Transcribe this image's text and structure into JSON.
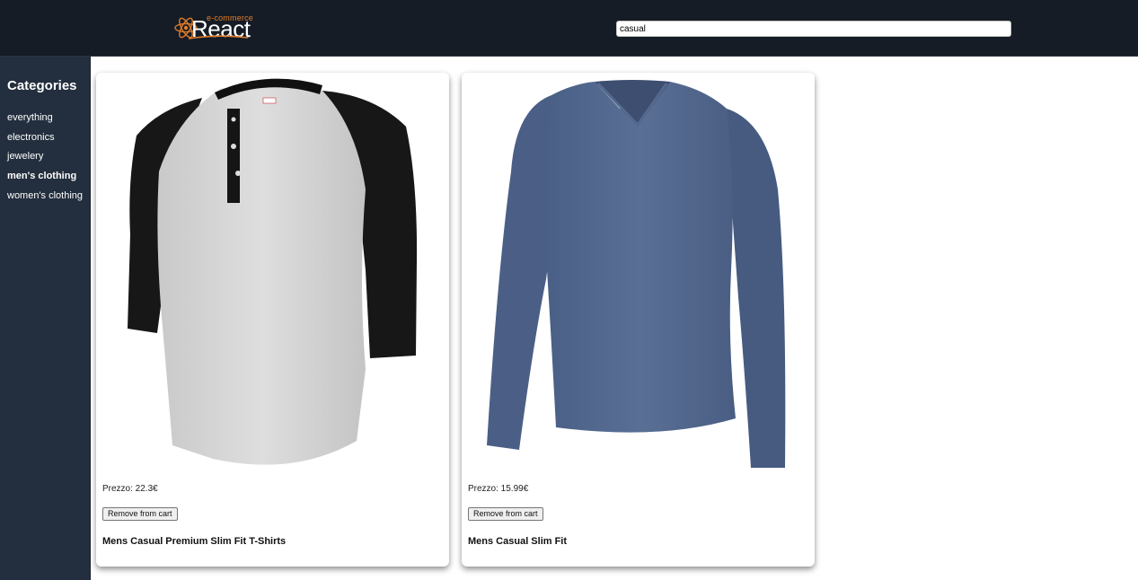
{
  "header": {
    "logo_small": "e-commerce",
    "logo_big": "React",
    "search_value": "casual"
  },
  "sidebar": {
    "title": "Categories",
    "items": [
      {
        "label": "everything"
      },
      {
        "label": "electronics"
      },
      {
        "label": "jewelery"
      },
      {
        "label": "men's clothing",
        "active": true
      },
      {
        "label": "women's clothing"
      }
    ]
  },
  "products": [
    {
      "price": "Prezzo: 22.3€",
      "button": "Remove from cart",
      "title": "Mens Casual Premium Slim Fit T-Shirts",
      "image": "grey raglan henley shirt with black 3/4 sleeves"
    },
    {
      "price": "Prezzo: 15.99€",
      "button": "Remove from cart",
      "title": "Mens Casual Slim Fit",
      "image": "blue long-sleeve v-neck shirt"
    }
  ],
  "colors": {
    "topbar": "#151c25",
    "sidebar": "#232f3e",
    "logo_accent": "#e07b2a"
  }
}
